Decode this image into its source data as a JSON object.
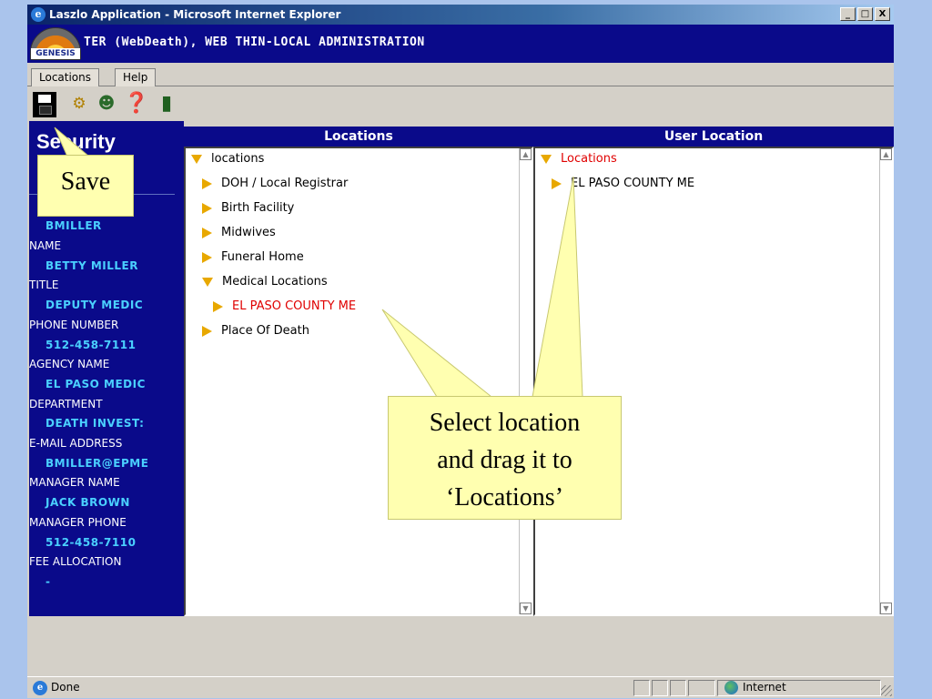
{
  "window": {
    "title": "Laszlo Application - Microsoft Internet Explorer",
    "controls": [
      "_",
      "□",
      "X"
    ]
  },
  "header": {
    "logo_text": "GENESIS",
    "title": "TER (WebDeath), WEB THIN-LOCAL ADMINISTRATION"
  },
  "menu": {
    "items": [
      "Locations",
      "Help"
    ]
  },
  "toolbar": {
    "icons": [
      "save-icon",
      "settings-icon",
      "user-icon",
      "help-book-icon",
      "exit-door-icon"
    ]
  },
  "sidebar": {
    "title": "Security",
    "fields": [
      {
        "label": "",
        "value": "BMILLER"
      },
      {
        "label": "NAME",
        "value": "BETTY MILLER"
      },
      {
        "label": "TITLE",
        "value": "DEPUTY MEDIC"
      },
      {
        "label": "PHONE NUMBER",
        "value": "512-458-7111"
      },
      {
        "label": "AGENCY NAME",
        "value": "EL PASO MEDIC"
      },
      {
        "label": "DEPARTMENT",
        "value": "DEATH INVEST:"
      },
      {
        "label": "E-MAIL ADDRESS",
        "value": "BMILLER@EPME"
      },
      {
        "label": "MANAGER NAME",
        "value": "JACK BROWN"
      },
      {
        "label": "MANAGER PHONE",
        "value": "512-458-7110"
      },
      {
        "label": "FEE ALLOCATION",
        "value": "-"
      }
    ]
  },
  "locations_panel": {
    "heading": "Locations",
    "root": "locations",
    "items": [
      "DOH / Local Registrar",
      "Birth Facility",
      "Midwives",
      "Funeral Home",
      "Medical Locations",
      "EL PASO COUNTY ME",
      "Place Of Death"
    ]
  },
  "user_location_panel": {
    "heading": "User Location",
    "root": "Locations",
    "items": [
      "EL PASO COUNTY ME"
    ]
  },
  "callouts": {
    "save": "Save",
    "drag_line1": "Select location",
    "drag_line2": "and drag it to",
    "drag_line3": "‘Locations’"
  },
  "statusbar": {
    "status": "Done",
    "zone": "Internet"
  },
  "colors": {
    "header_bg": "#0a0a8a",
    "field_value": "#4ad0ff",
    "selected_red": "#e00000",
    "tree_arrow": "#e8a800",
    "callout_bg": "#ffffb0"
  }
}
